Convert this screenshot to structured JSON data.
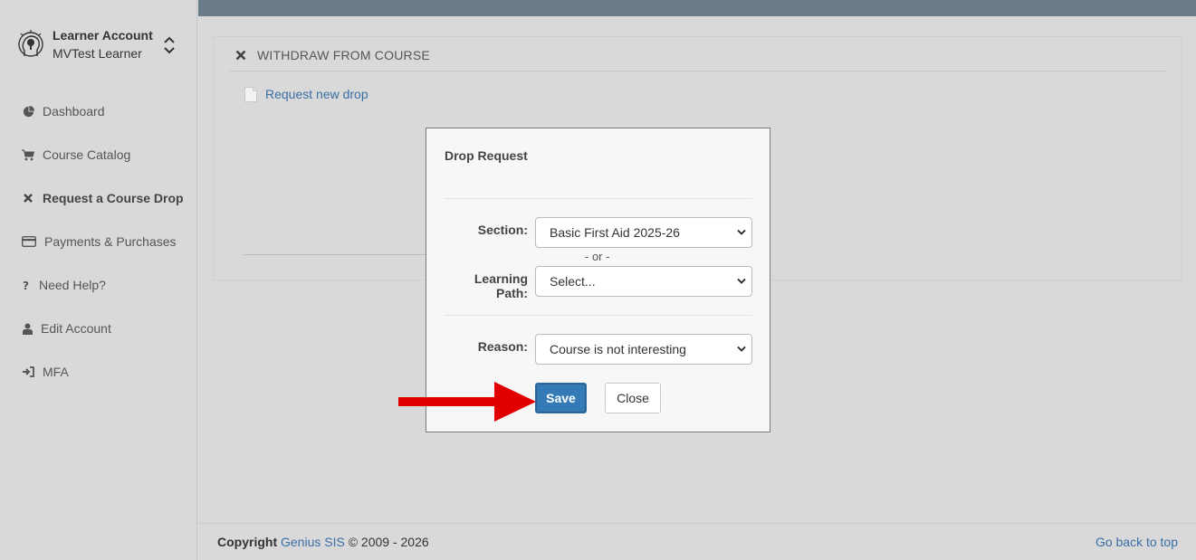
{
  "account": {
    "role": "Learner Account",
    "name": "MVTest Learner"
  },
  "nav": {
    "items": [
      {
        "label": "Dashboard",
        "icon": "pie-chart-icon"
      },
      {
        "label": "Course Catalog",
        "icon": "cart-icon"
      },
      {
        "label": "Request a Course Drop",
        "icon": "close-icon",
        "active": true
      },
      {
        "label": "Payments & Purchases",
        "icon": "credit-card-icon"
      },
      {
        "label": "Need Help?",
        "icon": "question-icon"
      },
      {
        "label": "Edit Account",
        "icon": "user-icon"
      },
      {
        "label": "MFA",
        "icon": "sign-in-icon"
      }
    ]
  },
  "panel": {
    "title": "WITHDRAW FROM COURSE",
    "request_link": "Request new drop"
  },
  "modal": {
    "title": "Drop Request",
    "section_label": "Section:",
    "section_value": "Basic First Aid 2025-26",
    "or_text": "- or -",
    "learning_path_label": "Learning Path:",
    "learning_path_value": "Select...",
    "reason_label": "Reason:",
    "reason_value": "Course is not interesting",
    "save_label": "Save",
    "close_label": "Close"
  },
  "footer": {
    "copyright_prefix": "Copyright",
    "brand": "Genius SIS",
    "copyright_suffix": "© 2009 - 2026",
    "back_to_top": "Go back to top"
  },
  "colors": {
    "topbar": "#6a7c88",
    "primary": "#337ab7",
    "link": "#3a6ea5",
    "annotation_arrow": "#e00000"
  }
}
